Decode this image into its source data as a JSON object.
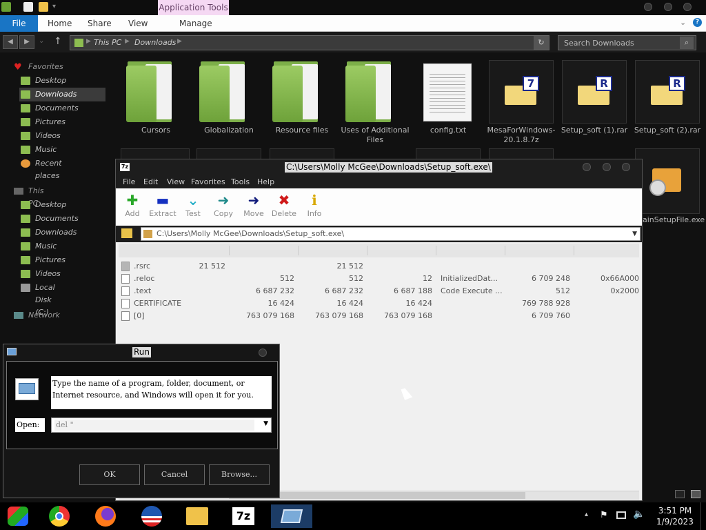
{
  "explorer": {
    "contextual_tab": "Application Tools",
    "ribbon_tabs": [
      "File",
      "Home",
      "Share",
      "View",
      "Manage"
    ],
    "breadcrumb": [
      "This PC",
      "Downloads"
    ],
    "search_placeholder": "Search Downloads",
    "nav": {
      "favorites_label": "Favorites",
      "favorites": [
        "Desktop",
        "Downloads",
        "Documents",
        "Pictures",
        "Videos",
        "Music",
        "Recent places"
      ],
      "thispc_label": "This PC",
      "thispc": [
        "Desktop",
        "Documents",
        "Downloads",
        "Music",
        "Pictures",
        "Videos",
        "Local Disk (C:)"
      ],
      "network_label": "Network"
    },
    "files": [
      {
        "name": "Cursors",
        "kind": "folder"
      },
      {
        "name": "Globalization",
        "kind": "folder"
      },
      {
        "name": "Resource files",
        "kind": "folder"
      },
      {
        "name": "Uses of Additional Files",
        "kind": "folder"
      },
      {
        "name": "config.txt",
        "kind": "text"
      },
      {
        "name": "MesaForWindows-20.1.8.7z",
        "kind": "7z"
      },
      {
        "name": "Setup_soft (1).rar",
        "kind": "rar"
      },
      {
        "name": "Setup_soft (2).rar",
        "kind": "rar"
      }
    ],
    "partial_file": "ainSetupFile.exe"
  },
  "zip": {
    "title": "C:\\Users\\Molly McGee\\Downloads\\Setup_soft.exe\\",
    "menu": [
      "File",
      "Edit",
      "View",
      "Favorites",
      "Tools",
      "Help"
    ],
    "toolbar": [
      {
        "label": "Add",
        "glyph": "✚",
        "color": "#2aa82a"
      },
      {
        "label": "Extract",
        "glyph": "▬",
        "color": "#1530c0"
      },
      {
        "label": "Test",
        "glyph": "✔",
        "color": "#2ab0c8"
      },
      {
        "label": "Copy",
        "glyph": "➜",
        "color": "#1f8a8a"
      },
      {
        "label": "Move",
        "glyph": "➜",
        "color": "#101a7a"
      },
      {
        "label": "Delete",
        "glyph": "✖",
        "color": "#d01a1a"
      },
      {
        "label": "Info",
        "glyph": "ℹ",
        "color": "#d8a800"
      }
    ],
    "address": "C:\\Users\\Molly McGee\\Downloads\\Setup_soft.exe\\",
    "rows": [
      {
        "name": ".rsrc",
        "c1": "21 512",
        "c2": "21 512",
        "c3": "",
        "c4": "",
        "c5": "",
        "c6": "",
        "folder": true
      },
      {
        "name": ".reloc",
        "c1": "512",
        "c2": "512",
        "c3": "12",
        "c4": "InitializedDat...",
        "c5": "6 709 248",
        "c6": "0x66A000",
        "folder": false
      },
      {
        "name": ".text",
        "c1": "6 687 232",
        "c2": "6 687 232",
        "c3": "6 687 188",
        "c4": "Code Execute ...",
        "c5": "512",
        "c6": "0x2000",
        "folder": false
      },
      {
        "name": "CERTIFICATE",
        "c1": "16 424",
        "c2": "16 424",
        "c3": "16 424",
        "c4": "",
        "c5": "769 788 928",
        "c6": "",
        "folder": false
      },
      {
        "name": "[0]",
        "c1": "763 079 168",
        "c2": "763 079 168",
        "c3": "763 079 168",
        "c4": "",
        "c5": "6 709 760",
        "c6": "",
        "folder": false
      }
    ]
  },
  "run": {
    "title": "Run",
    "description": "Type the name of a program, folder, document, or Internet resource, and Windows will open it for you.",
    "open_label": "Open:",
    "input_value": "del \"",
    "buttons": [
      "OK",
      "Cancel",
      "Browse..."
    ]
  },
  "taskbar": {
    "time": "3:51 PM",
    "date": "1/9/2023",
    "apps": [
      "Explorer",
      "Chrome",
      "Firefox",
      "Obama",
      "Files",
      "7z",
      "Run"
    ],
    "active_app": "Run"
  }
}
